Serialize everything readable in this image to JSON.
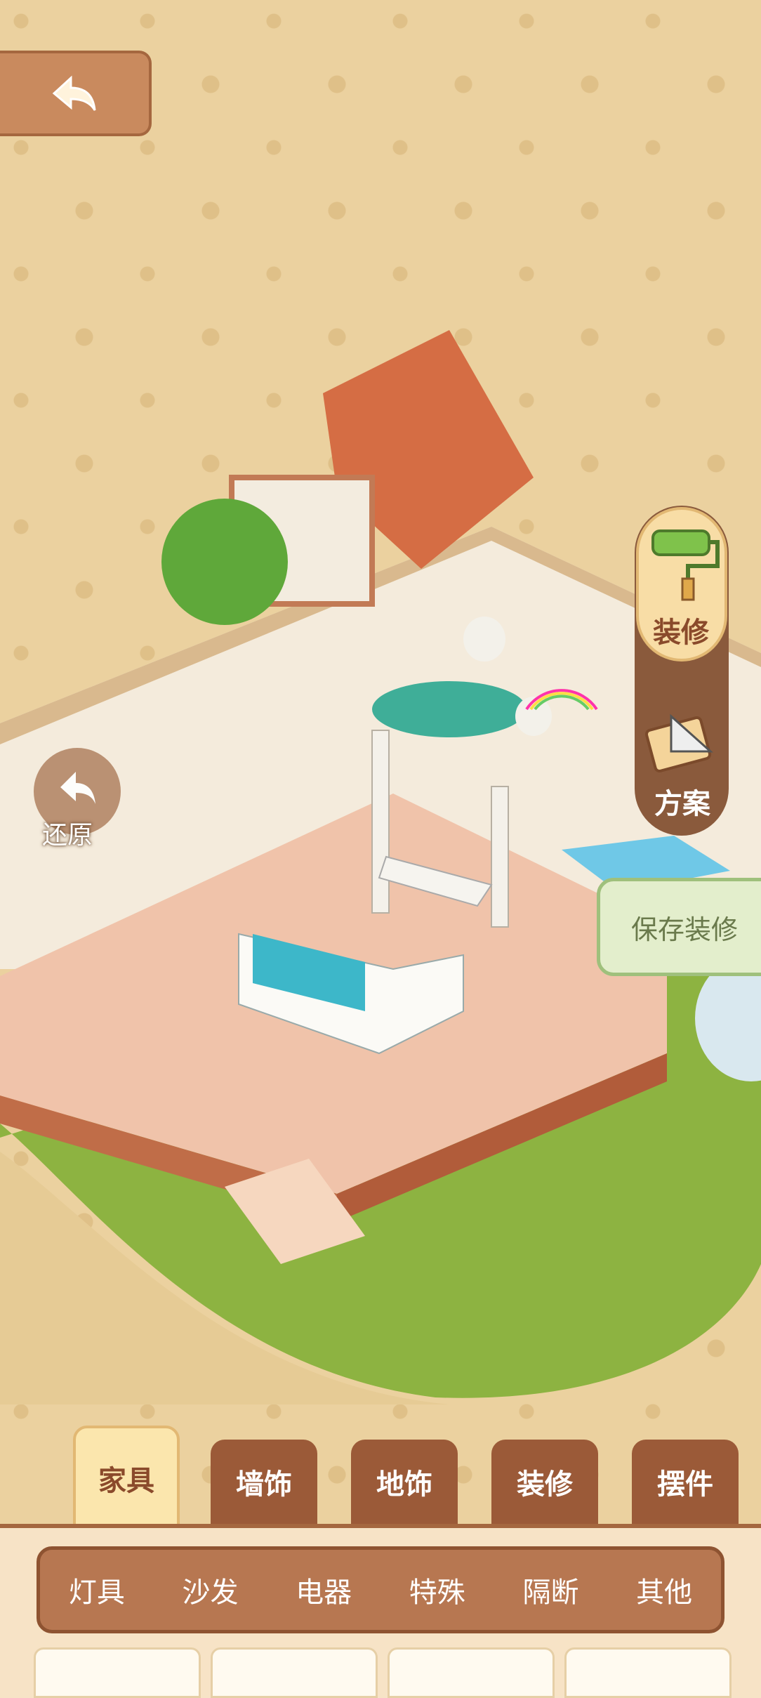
{
  "header": {
    "back_icon": "back-arrow-icon"
  },
  "scene": {
    "restore_label": "还原",
    "right_panel": {
      "decorate_label": "装修",
      "plan_label": "方案"
    },
    "save_label": "保存装修"
  },
  "tabs": [
    {
      "label": "家具",
      "active": true
    },
    {
      "label": "墙饰",
      "active": false
    },
    {
      "label": "地饰",
      "active": false
    },
    {
      "label": "装修",
      "active": false
    },
    {
      "label": "摆件",
      "active": false
    }
  ],
  "subtabs": [
    "灯具",
    "沙发",
    "电器",
    "特殊",
    "隔断",
    "其他"
  ],
  "colors": {
    "background": "#ebd19f",
    "tab": "#9b5a38",
    "active_tab": "#fbe6ad",
    "grass": "#8db341",
    "floor": "#f0c3aa"
  }
}
